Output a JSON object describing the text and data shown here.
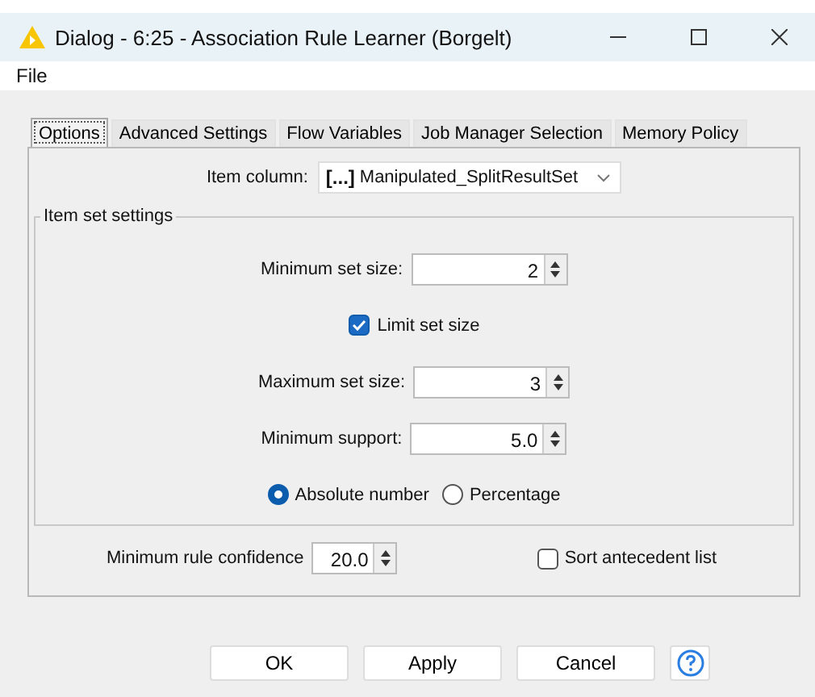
{
  "window": {
    "title": "Dialog - 6:25 - Association Rule Learner (Borgelt)"
  },
  "menu": [
    "File"
  ],
  "tabs": [
    {
      "label": "Options",
      "selected": true
    },
    {
      "label": "Advanced Settings",
      "selected": false
    },
    {
      "label": "Flow Variables",
      "selected": false
    },
    {
      "label": "Job Manager Selection",
      "selected": false
    },
    {
      "label": "Memory Policy",
      "selected": false
    }
  ],
  "item_column": {
    "label": "Item column:",
    "type_badge": "[...]",
    "value": "Manipulated_SplitResultSet"
  },
  "item_set_settings": {
    "title": "Item set settings",
    "rows": [
      {
        "kind": "spinner",
        "label": "Minimum set size:",
        "value": "2"
      },
      {
        "kind": "checkbox",
        "label": "Limit set size",
        "checked": true
      },
      {
        "kind": "spinner",
        "label": "Maximum set size:",
        "value": "3"
      },
      {
        "kind": "spinner",
        "label": "Minimum support:",
        "value": "5.0"
      },
      {
        "kind": "radio",
        "options": [
          {
            "label": "Absolute number",
            "selected": true
          },
          {
            "label": "Percentage",
            "selected": false
          }
        ]
      }
    ]
  },
  "min_rule_confidence": {
    "label": "Minimum rule confidence",
    "value": "20.0"
  },
  "sort_antecedent": {
    "label": "Sort antecedent list",
    "checked": false
  },
  "buttons": [
    "OK",
    "Apply",
    "Cancel"
  ]
}
